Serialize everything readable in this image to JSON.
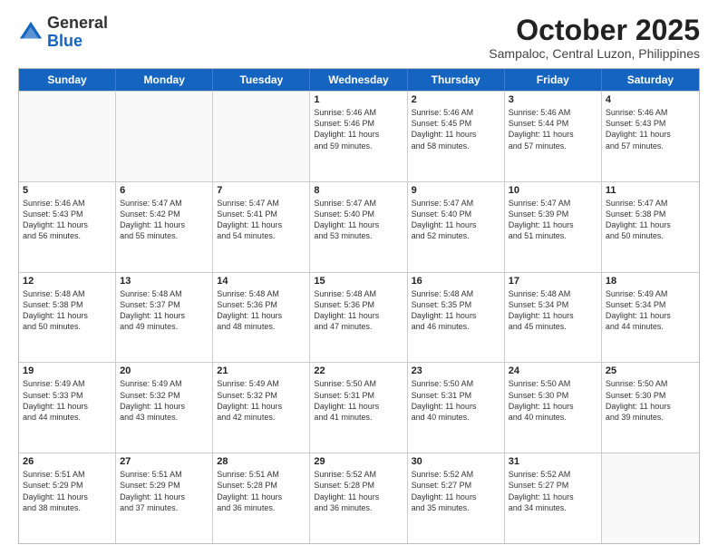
{
  "header": {
    "logo_general": "General",
    "logo_blue": "Blue",
    "month_title": "October 2025",
    "subtitle": "Sampaloc, Central Luzon, Philippines"
  },
  "days": [
    "Sunday",
    "Monday",
    "Tuesday",
    "Wednesday",
    "Thursday",
    "Friday",
    "Saturday"
  ],
  "rows": [
    [
      {
        "date": "",
        "info": ""
      },
      {
        "date": "",
        "info": ""
      },
      {
        "date": "",
        "info": ""
      },
      {
        "date": "1",
        "info": "Sunrise: 5:46 AM\nSunset: 5:46 PM\nDaylight: 11 hours\nand 59 minutes."
      },
      {
        "date": "2",
        "info": "Sunrise: 5:46 AM\nSunset: 5:45 PM\nDaylight: 11 hours\nand 58 minutes."
      },
      {
        "date": "3",
        "info": "Sunrise: 5:46 AM\nSunset: 5:44 PM\nDaylight: 11 hours\nand 57 minutes."
      },
      {
        "date": "4",
        "info": "Sunrise: 5:46 AM\nSunset: 5:43 PM\nDaylight: 11 hours\nand 57 minutes."
      }
    ],
    [
      {
        "date": "5",
        "info": "Sunrise: 5:46 AM\nSunset: 5:43 PM\nDaylight: 11 hours\nand 56 minutes."
      },
      {
        "date": "6",
        "info": "Sunrise: 5:47 AM\nSunset: 5:42 PM\nDaylight: 11 hours\nand 55 minutes."
      },
      {
        "date": "7",
        "info": "Sunrise: 5:47 AM\nSunset: 5:41 PM\nDaylight: 11 hours\nand 54 minutes."
      },
      {
        "date": "8",
        "info": "Sunrise: 5:47 AM\nSunset: 5:40 PM\nDaylight: 11 hours\nand 53 minutes."
      },
      {
        "date": "9",
        "info": "Sunrise: 5:47 AM\nSunset: 5:40 PM\nDaylight: 11 hours\nand 52 minutes."
      },
      {
        "date": "10",
        "info": "Sunrise: 5:47 AM\nSunset: 5:39 PM\nDaylight: 11 hours\nand 51 minutes."
      },
      {
        "date": "11",
        "info": "Sunrise: 5:47 AM\nSunset: 5:38 PM\nDaylight: 11 hours\nand 50 minutes."
      }
    ],
    [
      {
        "date": "12",
        "info": "Sunrise: 5:48 AM\nSunset: 5:38 PM\nDaylight: 11 hours\nand 50 minutes."
      },
      {
        "date": "13",
        "info": "Sunrise: 5:48 AM\nSunset: 5:37 PM\nDaylight: 11 hours\nand 49 minutes."
      },
      {
        "date": "14",
        "info": "Sunrise: 5:48 AM\nSunset: 5:36 PM\nDaylight: 11 hours\nand 48 minutes."
      },
      {
        "date": "15",
        "info": "Sunrise: 5:48 AM\nSunset: 5:36 PM\nDaylight: 11 hours\nand 47 minutes."
      },
      {
        "date": "16",
        "info": "Sunrise: 5:48 AM\nSunset: 5:35 PM\nDaylight: 11 hours\nand 46 minutes."
      },
      {
        "date": "17",
        "info": "Sunrise: 5:48 AM\nSunset: 5:34 PM\nDaylight: 11 hours\nand 45 minutes."
      },
      {
        "date": "18",
        "info": "Sunrise: 5:49 AM\nSunset: 5:34 PM\nDaylight: 11 hours\nand 44 minutes."
      }
    ],
    [
      {
        "date": "19",
        "info": "Sunrise: 5:49 AM\nSunset: 5:33 PM\nDaylight: 11 hours\nand 44 minutes."
      },
      {
        "date": "20",
        "info": "Sunrise: 5:49 AM\nSunset: 5:32 PM\nDaylight: 11 hours\nand 43 minutes."
      },
      {
        "date": "21",
        "info": "Sunrise: 5:49 AM\nSunset: 5:32 PM\nDaylight: 11 hours\nand 42 minutes."
      },
      {
        "date": "22",
        "info": "Sunrise: 5:50 AM\nSunset: 5:31 PM\nDaylight: 11 hours\nand 41 minutes."
      },
      {
        "date": "23",
        "info": "Sunrise: 5:50 AM\nSunset: 5:31 PM\nDaylight: 11 hours\nand 40 minutes."
      },
      {
        "date": "24",
        "info": "Sunrise: 5:50 AM\nSunset: 5:30 PM\nDaylight: 11 hours\nand 40 minutes."
      },
      {
        "date": "25",
        "info": "Sunrise: 5:50 AM\nSunset: 5:30 PM\nDaylight: 11 hours\nand 39 minutes."
      }
    ],
    [
      {
        "date": "26",
        "info": "Sunrise: 5:51 AM\nSunset: 5:29 PM\nDaylight: 11 hours\nand 38 minutes."
      },
      {
        "date": "27",
        "info": "Sunrise: 5:51 AM\nSunset: 5:29 PM\nDaylight: 11 hours\nand 37 minutes."
      },
      {
        "date": "28",
        "info": "Sunrise: 5:51 AM\nSunset: 5:28 PM\nDaylight: 11 hours\nand 36 minutes."
      },
      {
        "date": "29",
        "info": "Sunrise: 5:52 AM\nSunset: 5:28 PM\nDaylight: 11 hours\nand 36 minutes."
      },
      {
        "date": "30",
        "info": "Sunrise: 5:52 AM\nSunset: 5:27 PM\nDaylight: 11 hours\nand 35 minutes."
      },
      {
        "date": "31",
        "info": "Sunrise: 5:52 AM\nSunset: 5:27 PM\nDaylight: 11 hours\nand 34 minutes."
      },
      {
        "date": "",
        "info": ""
      }
    ]
  ]
}
